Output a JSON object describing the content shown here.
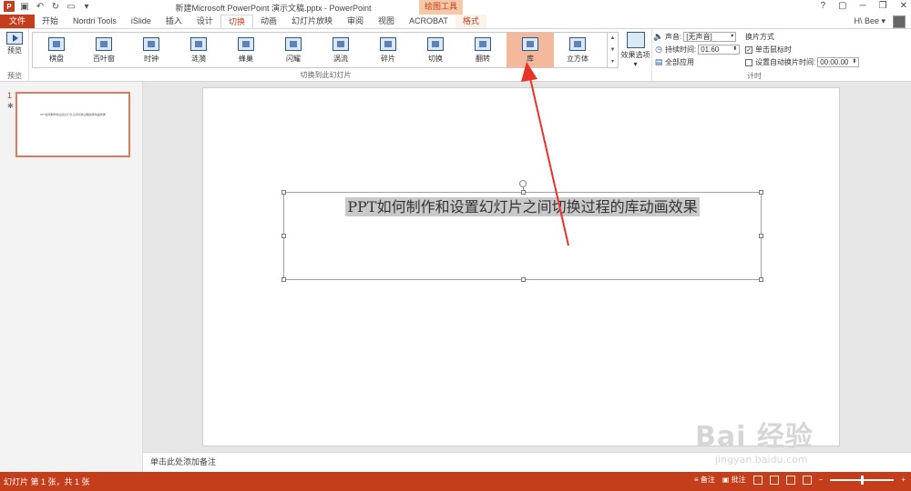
{
  "window": {
    "title": "新建Microsoft PowerPoint 演示文稿.pptx - PowerPoint",
    "context_tool": "绘图工具",
    "app_icon": "P",
    "controls": [
      "?",
      "▢",
      "─",
      "❐",
      "✕"
    ]
  },
  "tabs": [
    {
      "label": "文件"
    },
    {
      "label": "开始"
    },
    {
      "label": "Nordri Tools"
    },
    {
      "label": "iSlide"
    },
    {
      "label": "插入"
    },
    {
      "label": "设计"
    },
    {
      "label": "切换"
    },
    {
      "label": "动画"
    },
    {
      "label": "幻灯片放映"
    },
    {
      "label": "审阅"
    },
    {
      "label": "视图"
    },
    {
      "label": "ACROBAT"
    },
    {
      "label": "格式"
    }
  ],
  "user": {
    "name": "H\\ Bee ▾"
  },
  "ribbon": {
    "preview": {
      "button": "预览",
      "group": "预览"
    },
    "gallery_group": "切换到此幻灯片",
    "effects": [
      {
        "label": "棋盘"
      },
      {
        "label": "百叶窗"
      },
      {
        "label": "时钟"
      },
      {
        "label": "涟漪"
      },
      {
        "label": "蜂巢"
      },
      {
        "label": "闪耀"
      },
      {
        "label": "涡流"
      },
      {
        "label": "碎片"
      },
      {
        "label": "切换"
      },
      {
        "label": "翻转"
      },
      {
        "label": "库"
      },
      {
        "label": "立方体"
      }
    ],
    "selected_effect": "库",
    "effect_options": "效果选项",
    "timing": {
      "sound_label": "声音:",
      "sound_value": "[无声音]",
      "duration_label": "持续时间:",
      "duration_value": "01.60",
      "apply_all": "全部应用",
      "advance_title": "换片方式",
      "on_click": "单击鼠标时",
      "after_label": "设置自动换片时间:",
      "after_value": "00:00.00",
      "group": "计时"
    }
  },
  "slides_pane": {
    "number": "1",
    "star": "✱",
    "thumb_text": "PPT如何制作和设置幻灯片之间切换过程的库动画效果"
  },
  "slide": {
    "text": "PPT如何制作和设置幻灯片之间切换过程的库动画效果"
  },
  "notes": "单击此处添加备注",
  "watermark": {
    "main": "Bai 经验",
    "sub": "jingyan.baidu.com"
  },
  "status": {
    "left": "幻灯片 第 1 张，共 1 张",
    "notes": "备注",
    "comments": "批注"
  },
  "colors": {
    "accent": "#c43e1c",
    "selected_effect": "#f4b89d",
    "arrow": "#e8322a"
  }
}
